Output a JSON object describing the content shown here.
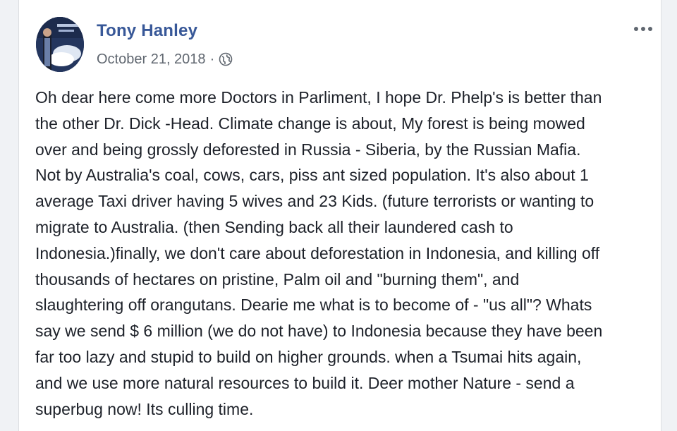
{
  "post": {
    "author": "Tony Hanley",
    "date": "October 21, 2018",
    "separator": "·",
    "privacy_icon": "globe-icon",
    "options_icon": "more-options-icon",
    "lines": [
      "Oh dear here come more Doctors in Parliment, I hope Dr. Phelp's is better than",
      "the other Dr. Dick -Head. Climate change is about, My forest is being mowed",
      "over and being grossly deforested in Russia - Siberia, by the Russian Mafia.",
      "Not by Australia's coal, cows, cars, piss ant sized population. It's also about 1",
      "average Taxi driver having 5 wives and 23 Kids. (future terrorists or wanting to",
      "migrate to Australia. (then Sending back all their laundered cash to",
      "Indonesia.)finally, we don't care about deforestation in Indonesia, and killing off",
      "thousands of hectares on pristine, Palm oil and \"burning them\", and",
      "slaughtering off orangutans. Dearie me what is to become of - \"us all\"? Whats",
      "say we send $ 6 million (we do not have) to Indonesia because they have been",
      "far too lazy and stupid to build on higher grounds. when a Tsumai hits again,",
      "and we use more natural resources to build it. Deer mother Nature - send a",
      "superbug now! Its culling time."
    ]
  },
  "colors": {
    "author_link": "#385898",
    "meta_text": "#606770",
    "body_text": "#1d2129",
    "background": "#f0f2f5",
    "card": "#ffffff"
  }
}
